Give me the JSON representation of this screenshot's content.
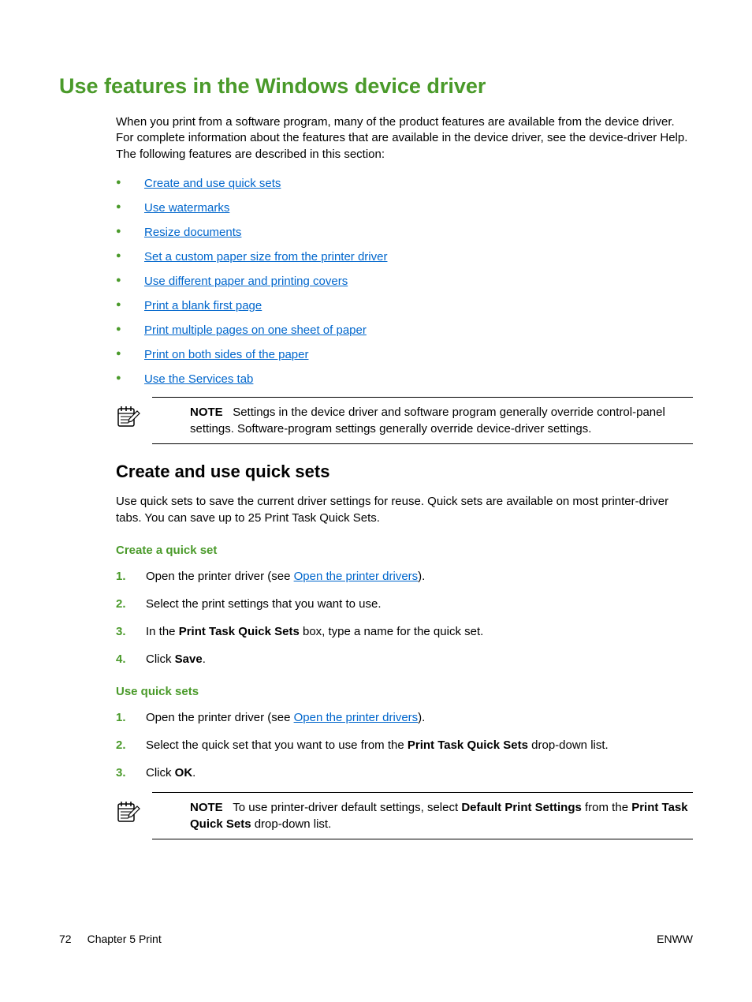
{
  "title": "Use features in the Windows device driver",
  "intro": "When you print from a software program, many of the product features are available from the device driver. For complete information about the features that are available in the device driver, see the device-driver Help. The following features are described in this section:",
  "links": [
    "Create and use quick sets",
    "Use watermarks",
    "Resize documents",
    "Set a custom paper size from the printer driver",
    "Use different paper and printing covers",
    "Print a blank first page",
    "Print multiple pages on one sheet of paper",
    "Print on both sides of the paper",
    "Use the Services tab"
  ],
  "note1_label": "NOTE",
  "note1_text": "Settings in the device driver and software program generally override control-panel settings. Software-program settings generally override device-driver settings.",
  "section_h2": "Create and use quick sets",
  "section_body": "Use quick sets to save the current driver settings for reuse. Quick sets are available on most printer-driver tabs. You can save up to 25 Print Task Quick Sets.",
  "create_h3": "Create a quick set",
  "create_steps": {
    "s1a": "Open the printer driver (see ",
    "s1link": "Open the printer drivers",
    "s1b": ").",
    "s2": "Select the print settings that you want to use.",
    "s3a": "In the ",
    "s3b1": "Print Task Quick Sets",
    "s3b": " box, type a name for the quick set.",
    "s4a": "Click ",
    "s4b1": "Save",
    "s4b": "."
  },
  "use_h3": "Use quick sets",
  "use_steps": {
    "s1a": "Open the printer driver (see ",
    "s1link": "Open the printer drivers",
    "s1b": ").",
    "s2a": "Select the quick set that you want to use from the ",
    "s2b1": "Print Task Quick Sets",
    "s2b": " drop-down list.",
    "s3a": "Click ",
    "s3b1": "OK",
    "s3b": "."
  },
  "note2_label": "NOTE",
  "note2_a": "To use printer-driver default settings, select ",
  "note2_b1": "Default Print Settings",
  "note2_b": " from the ",
  "note2_c1": "Print Task Quick Sets",
  "note2_c": " drop-down list.",
  "footer": {
    "page": "72",
    "chapter": "Chapter 5   Print",
    "lang": "ENWW"
  }
}
